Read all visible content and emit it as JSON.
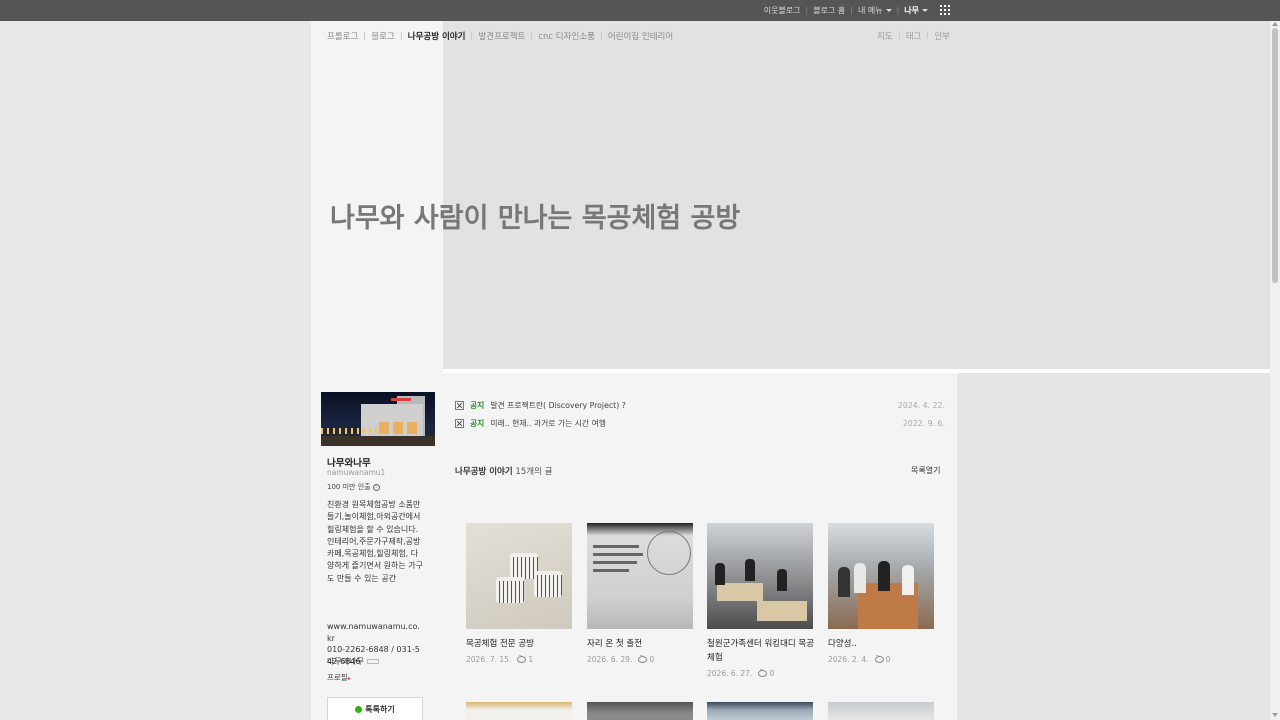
{
  "gnb": {
    "neighbor_blog": "이웃블로그",
    "blog_home": "블로그 홈",
    "my_menu": "내 메뉴",
    "user": "나무"
  },
  "category_menu": [
    "프롤로그",
    "블로그",
    "나무공방 이야기",
    "발견프로젝트",
    "cnc 디자인소품",
    "어린이집 인테리어"
  ],
  "category_active_index": 2,
  "util_menu": [
    "지도",
    "태그",
    "안부"
  ],
  "blog_title": "나무와 사람이 만나는 목공체험 공방",
  "profile": {
    "nickname": "나무와나무",
    "blog_id": "namuwanamu1",
    "visitors": "100 미만 인출",
    "intro": "친환경 원목체험공방 소품만들기,놀이체험,아외공간에서 힐링체험을 할 수 있습니다. 인테리어,주문가구제작,공방카페,목공체험,힐링체험, 다양하게 즐기면서 원하는 가구도 만들 수 있는 공간",
    "website": "www.namuwanamu.co.kr",
    "phone": "010-2262-6848 / 031-542-6846",
    "nick_repeat": "나무와나무",
    "profile_link": "프로필",
    "talk_button": "톡톡하기"
  },
  "notices": [
    {
      "tag": "공지",
      "title": "발견 프로젝트란( Discovery Project) ?",
      "date": "2024. 4. 22."
    },
    {
      "tag": "공지",
      "title": "미래.. 현재.. 과거로 가는 시간 여행",
      "date": "2022. 9. 6."
    }
  ],
  "list": {
    "category": "나무공방 이야기",
    "count": "15개의 글",
    "toggle": "목록열기"
  },
  "posts": [
    {
      "title": "목공체험 전문 공방",
      "date": "2026. 7. 15.",
      "comments": "1"
    },
    {
      "title": "자리 온 첫 출전",
      "date": "2026. 6. 29.",
      "comments": "0"
    },
    {
      "title": "철원군가족센터 워킹대디 목공체험",
      "date": "2026. 6. 27.",
      "comments": "0"
    },
    {
      "title": "다양성..",
      "date": "2026. 2. 4.",
      "comments": "0"
    }
  ],
  "colors": {
    "gnb_bg": "#555555",
    "notice_tag": "#2e8a2e",
    "talk_icon": "#2db400"
  }
}
